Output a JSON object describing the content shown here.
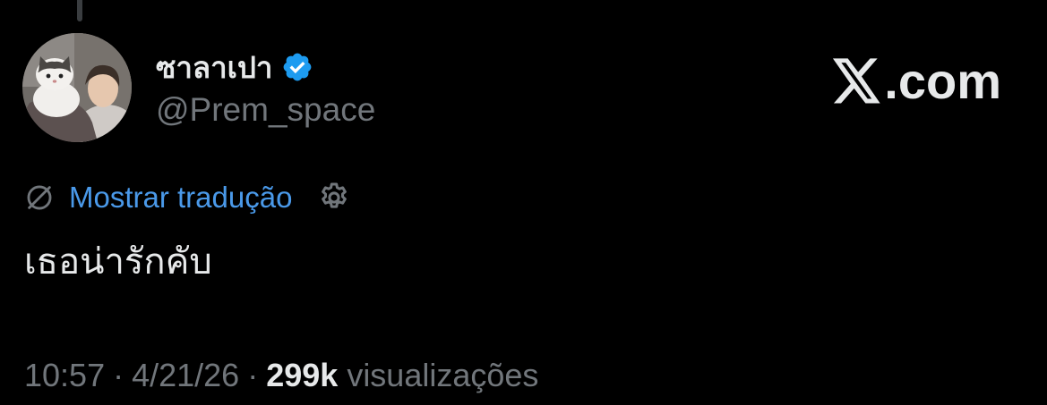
{
  "post": {
    "author": {
      "display_name": "ซาลาเปา",
      "handle": "@Prem_space",
      "verified_icon": "verified-badge-icon",
      "avatar": "avatar-photo-man-holding-cat"
    },
    "brand": {
      "logo_icon": "x-logo-icon",
      "suffix": ".com"
    },
    "translate": {
      "icon": "translate-globe-icon",
      "label": "Mostrar tradução",
      "settings_icon": "gear-icon"
    },
    "text": "เธอน่ารักคับ",
    "meta": {
      "time": "10:57",
      "separator": "·",
      "date": "4/21/26",
      "views_count": "299k",
      "views_label": "visualizações"
    }
  },
  "colors": {
    "background": "#000000",
    "primary_text": "#e7e9ea",
    "secondary_text": "#71767b",
    "link": "#4a99e9",
    "verified_badge": "#1d9bf0"
  }
}
